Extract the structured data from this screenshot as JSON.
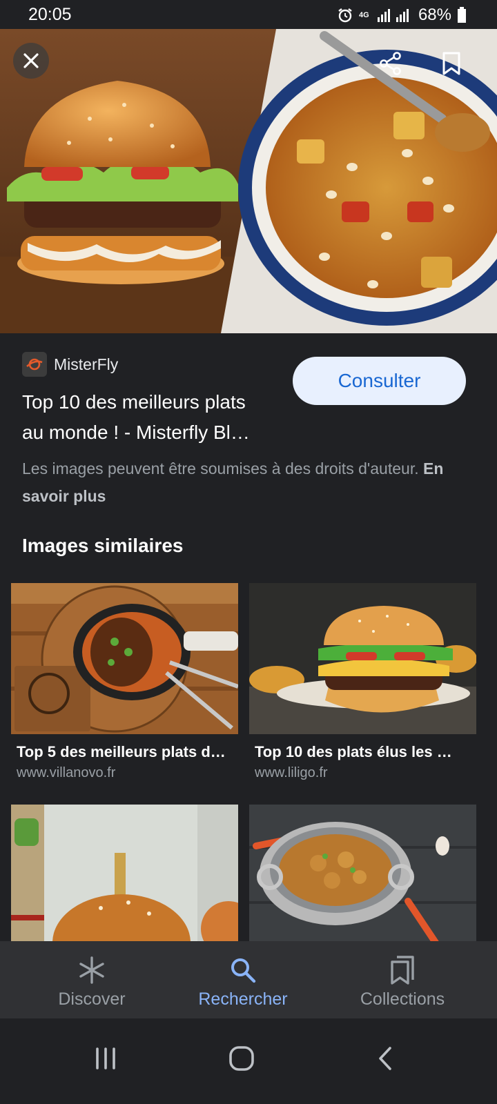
{
  "status_bar": {
    "time": "20:05",
    "network": "4G",
    "battery": "68%"
  },
  "hero": {
    "close_icon": "close-icon",
    "share_icon": "share-icon",
    "bookmark_icon": "bookmark-icon"
  },
  "result": {
    "source_name": "MisterFly",
    "title_line1": "Top 10 des meilleurs plats",
    "title_line2": "au monde ! - Misterfly Bl…",
    "visit_label": "Consulter",
    "copyright_text": "Les images peuvent être soumises à des droits d'auteur. ",
    "learn_more": "En savoir plus"
  },
  "similar": {
    "heading": "Images similaires",
    "items": [
      {
        "title": "Top 5 des meilleurs plats d…",
        "domain": "www.villanovo.fr"
      },
      {
        "title": "Top 10 des plats élus les …",
        "domain": "www.liligo.fr"
      },
      {
        "title": "",
        "domain": ""
      },
      {
        "title": "",
        "domain": ""
      }
    ]
  },
  "bottom_nav": {
    "items": [
      {
        "label": "Discover",
        "icon": "asterisk-icon"
      },
      {
        "label": "Rechercher",
        "icon": "search-icon"
      },
      {
        "label": "Collections",
        "icon": "collections-icon"
      }
    ],
    "active_color": "#8ab4f8"
  },
  "colors": {
    "background": "#202124",
    "accent": "#1967d2",
    "button_bg": "#e8f0fe"
  }
}
